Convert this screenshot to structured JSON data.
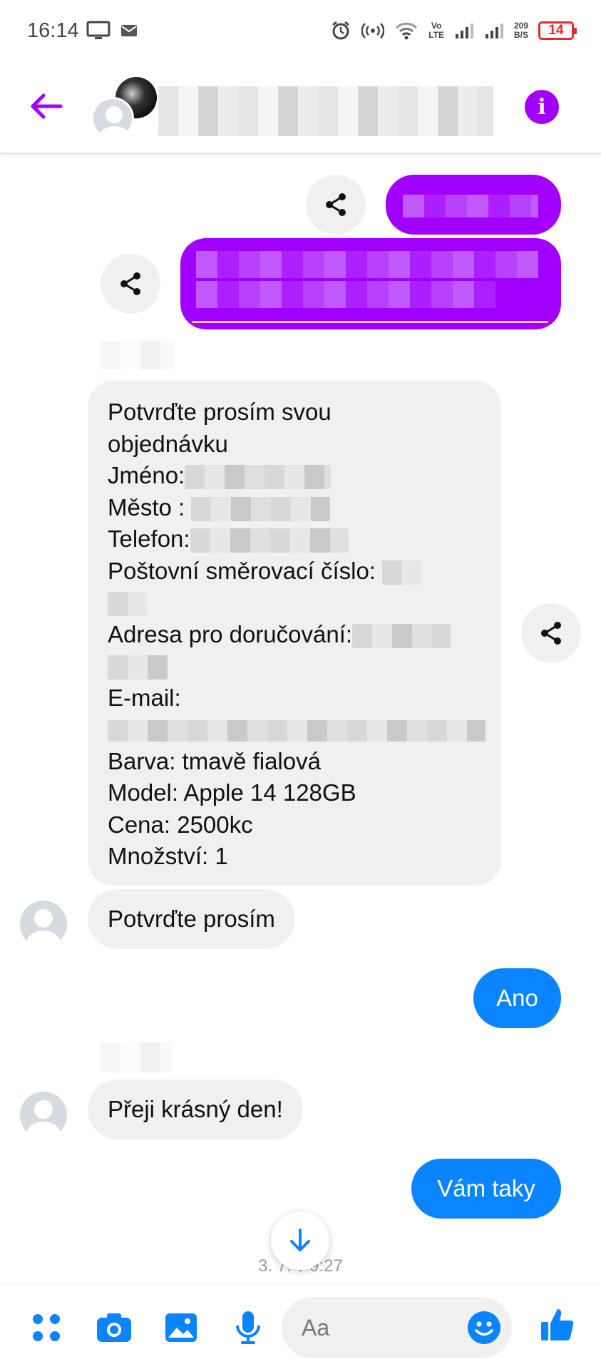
{
  "status_bar": {
    "time": "16:14",
    "volte_top": "Vo",
    "volte_bottom": "LTE",
    "net_speed_value": "209",
    "net_speed_unit": "B/S",
    "battery": "14"
  },
  "header": {
    "back_icon": "arrow-left-icon",
    "info_icon": "info-icon"
  },
  "order_message": {
    "title": "Potvrďte prosím svou objednávku",
    "line_name": "Jméno:",
    "line_city": "Město :",
    "line_phone": "Telefon:",
    "line_zip": "Poštovní směrovací číslo:",
    "line_address": "Adresa pro doručování:",
    "line_email": "E-mail:",
    "line_color": "Barva: tmavě fialová",
    "line_model": "Model: Apple 14 128GB",
    "line_price": "Cena: 2500kc",
    "line_qty": "Množství: 1"
  },
  "messages": {
    "confirm_please": "Potvrďte prosím",
    "reply_yes": "Ano",
    "wish": "Přeji krásný den!",
    "reply_you_too": "Vám taky"
  },
  "timestamp": "3. 7. v 9:27",
  "composer": {
    "placeholder": "Aa",
    "icons": [
      "apps-icon",
      "camera-icon",
      "gallery-icon",
      "microphone-icon",
      "emoji-icon",
      "like-icon"
    ]
  },
  "colors": {
    "accent_purple": "#a100ff",
    "outgoing_blue": "#0b84ff",
    "incoming_gray": "#f0f0f0"
  }
}
